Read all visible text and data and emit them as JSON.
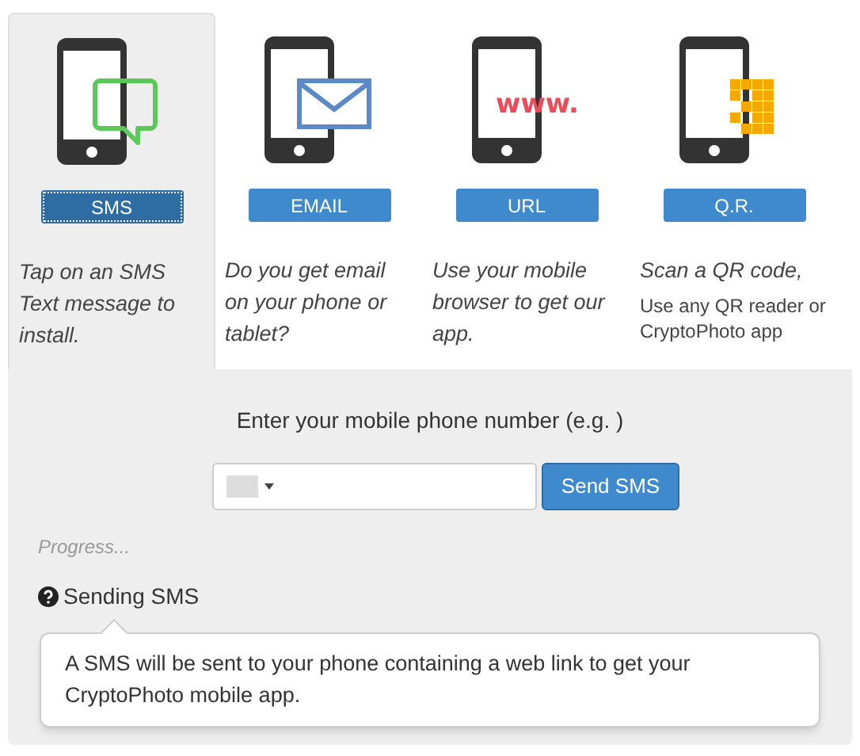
{
  "tabs": [
    {
      "kind": "sms",
      "label": "SMS",
      "selected": true,
      "description": "Tap on an SMS Text message to install."
    },
    {
      "kind": "email",
      "label": "EMAIL",
      "selected": false,
      "description": "Do you get email on your phone or tablet?"
    },
    {
      "kind": "url",
      "label": "URL",
      "selected": false,
      "description": "Use your mobile browser to get our app.",
      "screen_text": "www."
    },
    {
      "kind": "qr",
      "label": "Q.R.",
      "selected": false,
      "description": "Scan a QR code,",
      "note": "Use any QR reader or CryptoPhoto app"
    }
  ],
  "prompt": "Enter your mobile phone number (e.g. )",
  "send_button": "Send SMS",
  "progress_label": "Progress...",
  "status": "Sending SMS",
  "popover": "A SMS will be sent to your phone containing a web link to get your CryptoPhoto mobile app."
}
